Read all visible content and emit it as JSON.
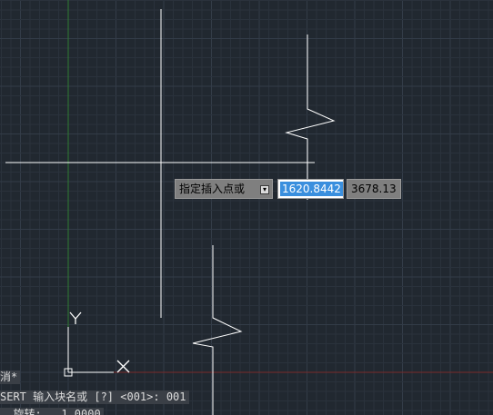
{
  "drawing": {
    "ucs_x_label": "X",
    "ucs_y_label": "Y"
  },
  "dynamic_input": {
    "prompt_label": "指定插入点或",
    "dropdown_icon": "dropdown-arrow-icon",
    "x_value": "1620.8442",
    "y_value": "3678.13"
  },
  "command_history": {
    "line1": "消*",
    "line2": "SERT 输入块名或 [?] <001>: 001",
    "line3": "  旋转:   1.0000"
  },
  "colors": {
    "background": "#212830",
    "grid_minor": "#2a323c",
    "grid_major": "#333c48",
    "crosshair": "#ffffff",
    "y_axis": "#2e7d32",
    "x_axis": "#8b2b2b",
    "selection": "#3a8fde"
  }
}
